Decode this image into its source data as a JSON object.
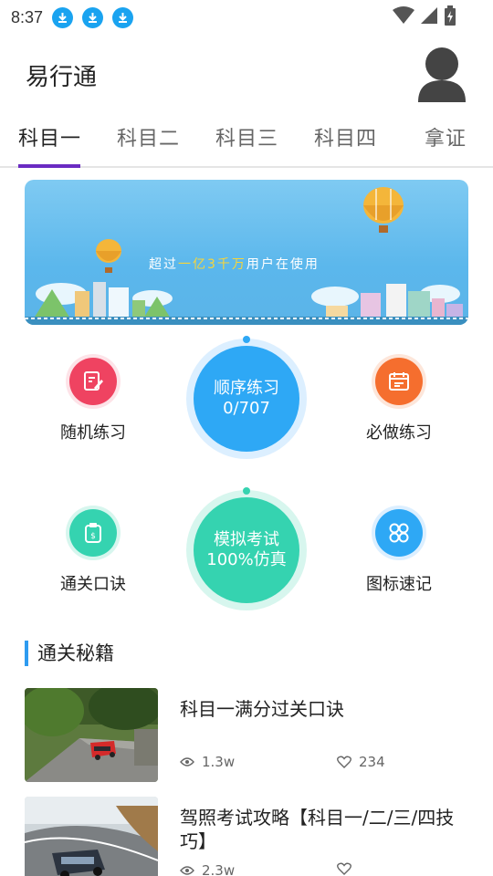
{
  "status_bar": {
    "time": "8:37"
  },
  "header": {
    "app_title": "易行通"
  },
  "tabs": [
    {
      "label": "科目一",
      "active": true
    },
    {
      "label": "科目二",
      "active": false
    },
    {
      "label": "科目三",
      "active": false
    },
    {
      "label": "科目四",
      "active": false
    },
    {
      "label": "拿证",
      "active": false
    }
  ],
  "banner": {
    "text_prefix": "超过",
    "text_highlight": "一亿3千万",
    "text_suffix": "用户在使用"
  },
  "practice": {
    "random": {
      "label": "随机练习",
      "icon": "edit-icon"
    },
    "sequential": {
      "line1": "顺序练习",
      "line2": "0/707"
    },
    "must_do": {
      "label": "必做练习",
      "icon": "calendar-icon"
    },
    "mnemonic": {
      "label": "通关口诀",
      "icon": "clipboard-icon"
    },
    "mock_exam": {
      "line1": "模拟考试",
      "line2": "100%仿真"
    },
    "icon_memo": {
      "label": "图标速记",
      "icon": "grid-icon"
    }
  },
  "section": {
    "title": "通关秘籍"
  },
  "articles": [
    {
      "title": "科目一满分过关口诀",
      "views": "1.3w",
      "likes": "234"
    },
    {
      "title": "驾照考试攻略【科目一/二/三/四技巧】",
      "views": "2.3w",
      "likes": ""
    }
  ],
  "colors": {
    "accent_purple": "#6a2bc2",
    "blue": "#2ea8f5",
    "teal": "#35d3b0",
    "red": "#ef4361",
    "orange": "#f56e2e",
    "section_bar": "#2e9bf0"
  }
}
